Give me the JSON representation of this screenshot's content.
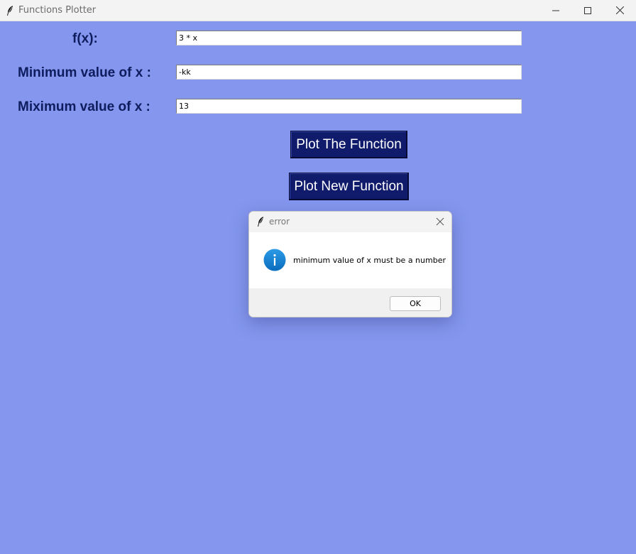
{
  "window": {
    "title": "Functions Plotter",
    "background_color": "#8496ee"
  },
  "form": {
    "fx_label": "f(x):",
    "fx_value": "3 * x",
    "min_label": "Minimum value of x :",
    "min_value": "-kk",
    "max_label": "Miximum value of x :",
    "max_value": "13"
  },
  "buttons": {
    "plot_label": "Plot The Function",
    "new_label": "Plot New Function",
    "color": "#101b6c"
  },
  "dialog": {
    "title": "error",
    "message": "minimum value of x must be a number",
    "ok_label": "OK",
    "icon": "info-icon"
  }
}
